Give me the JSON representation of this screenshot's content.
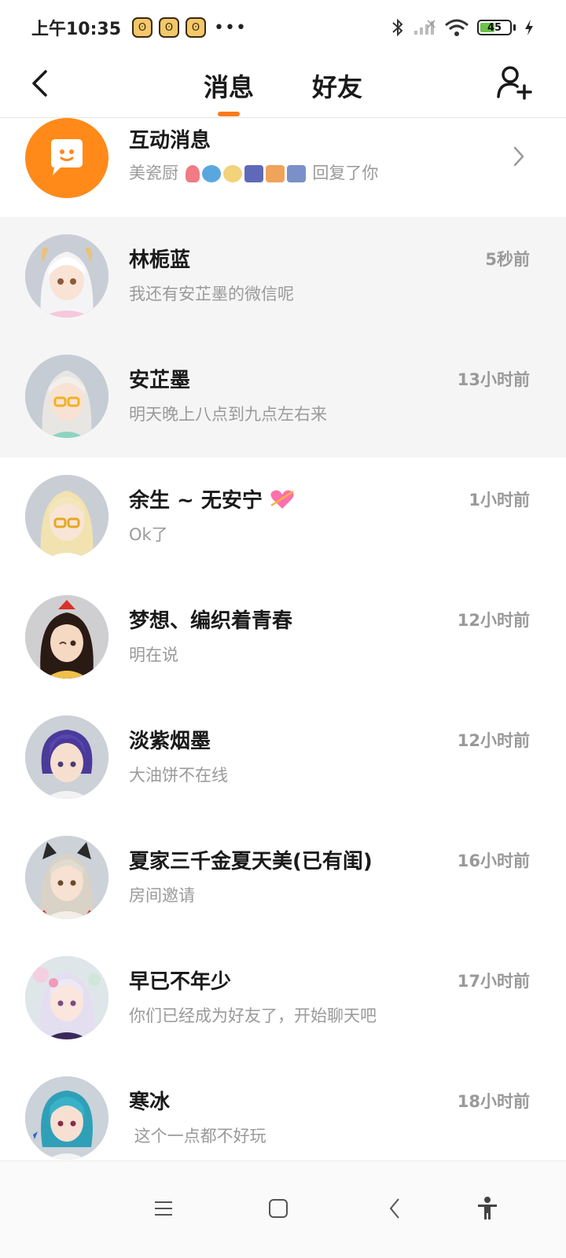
{
  "status_bar": {
    "time": "上午10:35",
    "notification_icons": [
      "app-face-icon",
      "app-face-icon",
      "app-face-icon"
    ],
    "more_indicator": "•••",
    "battery_level": "45"
  },
  "header": {
    "tabs": [
      {
        "label": "消息",
        "active": true
      },
      {
        "label": "好友",
        "active": false
      }
    ]
  },
  "interactive": {
    "title": "互动消息",
    "sender": "美瓷厨",
    "suffix": "回复了你"
  },
  "conversations": [
    {
      "name": "林栀蓝",
      "message": "我还有安芷墨的微信呢",
      "time": "5秒前",
      "pinned": true
    },
    {
      "name": "安芷墨",
      "message": "明天晚上八点到九点左右来",
      "time": "13小时前",
      "pinned": true
    },
    {
      "name": "余生 ~ 无安宁",
      "message": "Ok了",
      "time": "1小时前",
      "pinned": false
    },
    {
      "name": "梦想、编织着青春",
      "message": "明在说",
      "time": "12小时前",
      "pinned": false
    },
    {
      "name": "淡紫烟墨",
      "message": "大油饼不在线",
      "time": "12小时前",
      "pinned": false
    },
    {
      "name": "夏家三千金夏天美(已有闺)",
      "message": "房间邀请",
      "time": "16小时前",
      "pinned": false
    },
    {
      "name": "早已不年少",
      "message": "你们已经成为好友了，开始聊天吧",
      "time": "17小时前",
      "pinned": false
    },
    {
      "name": "寒冰",
      "message": " 这个一点都不好玩",
      "time": "18小时前",
      "pinned": false
    }
  ],
  "colors": {
    "accent": "#ff7a1a",
    "pinned_bg": "#f5f5f5",
    "subtext": "#9a9a9a"
  }
}
